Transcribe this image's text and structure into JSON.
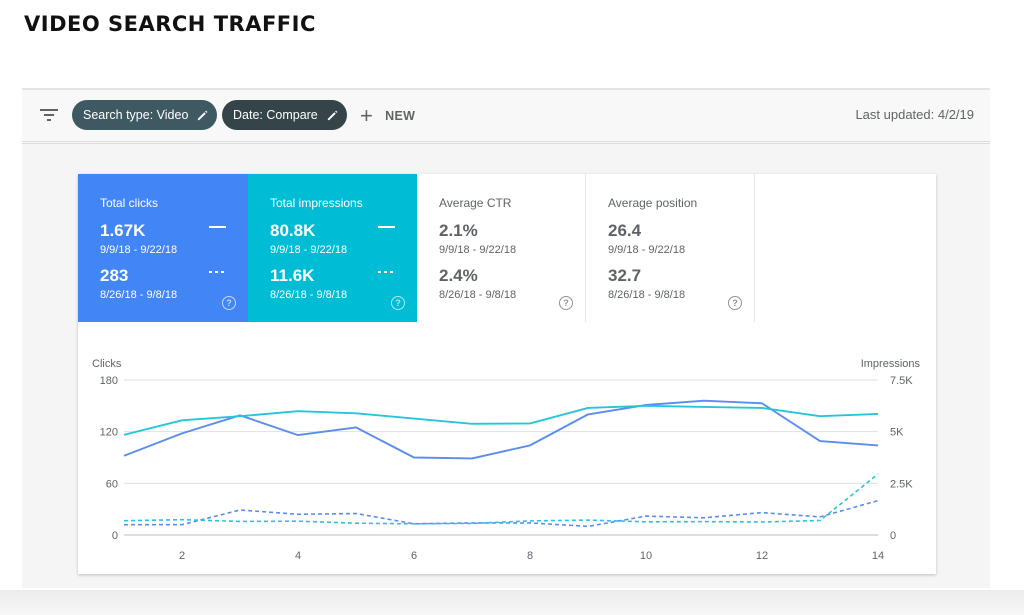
{
  "heading": "VIDEO SEARCH TRAFFIC",
  "toolbar": {
    "filter_icon": "filter-icon",
    "chips": [
      {
        "label": "Search type: Video",
        "icon": "pencil-icon"
      },
      {
        "label": "Date: Compare",
        "icon": "pencil-icon"
      }
    ],
    "new_label": "NEW",
    "new_icon": "plus-icon",
    "last_updated": "Last updated: 4/2/19"
  },
  "metrics": [
    {
      "title": "Total clicks",
      "value1": "1.67K",
      "range1": "9/9/18 - 9/22/18",
      "value2": "283",
      "range2": "8/26/18 - 9/8/18",
      "selected": true,
      "color": "#4285f4"
    },
    {
      "title": "Total impressions",
      "value1": "80.8K",
      "range1": "9/9/18 - 9/22/18",
      "value2": "11.6K",
      "range2": "8/26/18 - 9/8/18",
      "selected": true,
      "color": "#00bcd4"
    },
    {
      "title": "Average CTR",
      "value1": "2.1%",
      "range1": "9/9/18 - 9/22/18",
      "value2": "2.4%",
      "range2": "8/26/18 - 9/8/18",
      "selected": false
    },
    {
      "title": "Average position",
      "value1": "26.4",
      "range1": "9/9/18 - 9/22/18",
      "value2": "32.7",
      "range2": "8/26/18 - 9/8/18",
      "selected": false
    }
  ],
  "chart_data": {
    "type": "line",
    "left_axis_label": "Clicks",
    "right_axis_label": "Impressions",
    "left_ylim": [
      0,
      180
    ],
    "right_ylim": [
      0,
      7500
    ],
    "left_ticks": [
      "0",
      "60",
      "120",
      "180"
    ],
    "right_ticks": [
      "0",
      "2.5K",
      "5K",
      "7.5K"
    ],
    "x": [
      1,
      2,
      3,
      4,
      5,
      6,
      7,
      8,
      9,
      10,
      11,
      12,
      13,
      14
    ],
    "x_tick_labels": [
      "2",
      "4",
      "6",
      "8",
      "10",
      "12",
      "14"
    ],
    "grid": true,
    "series": [
      {
        "axis": "left",
        "style": "solid",
        "color": "#5b8def",
        "values": [
          92,
          118,
          139,
          116,
          125,
          90,
          89,
          104,
          140,
          151,
          156,
          153,
          109,
          104
        ]
      },
      {
        "axis": "right",
        "style": "solid",
        "color": "#26c6da",
        "values": [
          4850,
          5550,
          5750,
          5990,
          5890,
          5630,
          5380,
          5400,
          6150,
          6250,
          6200,
          6150,
          5750,
          5860
        ]
      },
      {
        "axis": "left",
        "style": "dashed",
        "color": "#5b8def",
        "values": [
          12,
          12,
          29,
          24,
          25,
          13,
          14,
          14,
          10,
          22,
          20,
          26,
          21,
          40
        ]
      },
      {
        "axis": "right",
        "style": "dashed",
        "color": "#26c6da",
        "values": [
          690,
          740,
          660,
          670,
          570,
          540,
          560,
          680,
          720,
          640,
          650,
          630,
          700,
          2950
        ]
      }
    ]
  }
}
